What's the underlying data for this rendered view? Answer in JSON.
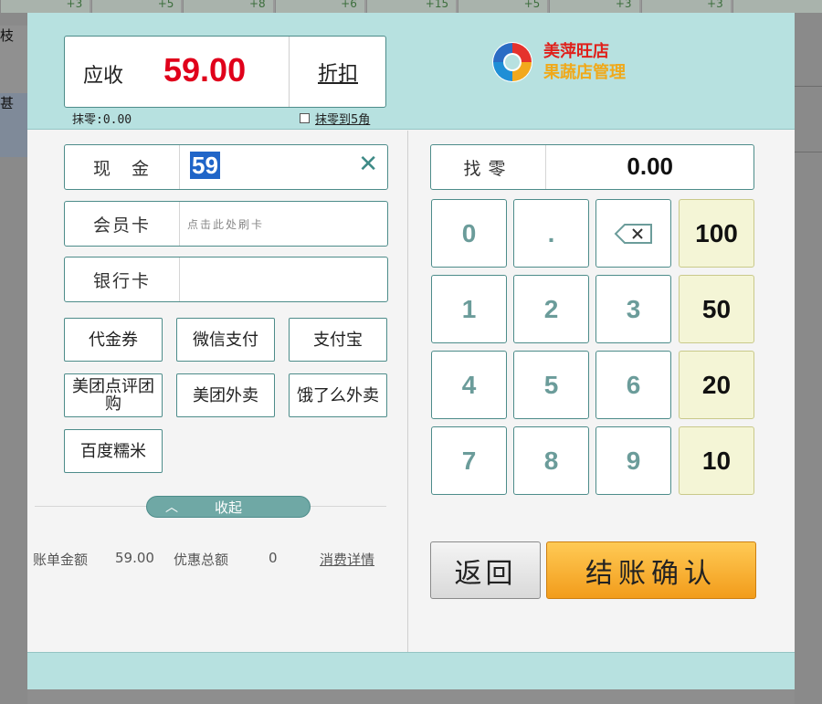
{
  "background": {
    "top_cells": [
      "+3",
      "+5",
      "+8",
      "+6",
      "+15",
      "+5",
      "+3",
      "+3",
      ""
    ],
    "left_labels": [
      "枝",
      "甚"
    ]
  },
  "header": {
    "amount_label": "应收",
    "amount_value": "59.00",
    "discount_label": "折扣",
    "rounding_text": "抹零:0.00",
    "round_to_5_label": "抹零到5角",
    "round_to_5_checked": false,
    "brand_name": "美萍旺店",
    "brand_subtitle": "果蔬店管理"
  },
  "payment": {
    "cash_label": "现　金",
    "cash_value": "59",
    "member_card_label": "会员卡",
    "member_card_placeholder": "点击此处刷卡",
    "bank_card_label": "银行卡",
    "bank_card_value": "",
    "methods": [
      "代金券",
      "微信支付",
      "支付宝",
      "美团点评团购",
      "美团外卖",
      "饿了么外卖",
      "百度糯米"
    ]
  },
  "collapse_label": "收起",
  "summary": {
    "bill_label": "账单金额",
    "bill_value": "59.00",
    "discount_total_label": "优惠总额",
    "discount_total_value": "0",
    "details_link": "消费详情"
  },
  "change": {
    "label": "找零",
    "value": "0.00"
  },
  "keypad": {
    "digits": [
      "0",
      ".",
      "⌫",
      "1",
      "2",
      "3",
      "4",
      "5",
      "6",
      "7",
      "8",
      "9"
    ],
    "quick": [
      "100",
      "50",
      "20",
      "10"
    ]
  },
  "actions": {
    "back_label": "返回",
    "confirm_label": "结账确认"
  },
  "colors": {
    "header_bg": "#b7e1e0",
    "amount_red": "#e0001b",
    "accent_teal": "#4d8c8a",
    "confirm_orange": "#f29c1b",
    "quick_key_bg": "#f4f5d6"
  }
}
